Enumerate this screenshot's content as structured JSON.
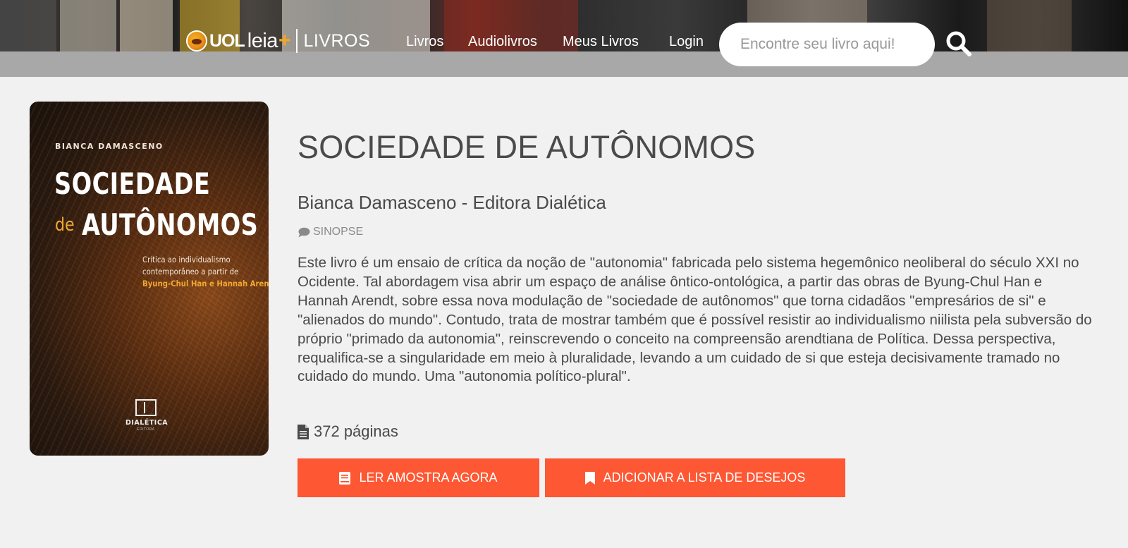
{
  "header": {
    "logo": {
      "brand": "UOL",
      "product": "leia",
      "plus": "+",
      "section": "LIVROS"
    },
    "nav": [
      "Livros",
      "Audiolivros",
      "Meus Livros",
      "Login"
    ],
    "search": {
      "placeholder": "Encontre seu livro aqui!",
      "value": ""
    }
  },
  "cover": {
    "author": "BIANCA DAMASCENO",
    "title_line1": "SOCIEDADE",
    "title_de": "de",
    "title_line2": "AUTÔNOMOS",
    "subtitle_line1": "Crítica ao individualismo",
    "subtitle_line2": "contemporâneo a partir de",
    "subtitle_line3": "Byung-Chul Han e Hannah Arendt",
    "publisher": "DIALÉTICA",
    "publisher_sub": "EDITORA"
  },
  "book": {
    "title": "SOCIEDADE DE AUTÔNOMOS",
    "author_publisher": "Bianca Damasceno - Editora Dialética",
    "synopsis_label": "SINOPSE",
    "synopsis": "Este livro é um ensaio de crítica da noção de \"autonomia\" fabricada pelo sistema hegemônico neoliberal do século XXI no Ocidente. Tal abordagem visa abrir um espaço de análise ôntico-ontológica, a partir das obras de Byung-Chul Han e Hannah Arendt, sobre essa nova modulação de \"sociedade de autônomos\" que torna cidadãos \"empresários de si\" e \"alienados do mundo\". Contudo, trata de mostrar também que é possível resistir ao individualismo niilista pela subversão do próprio \"primado da autonomia\", reinscrevendo o conceito na compreensão arendtiana de Política. Dessa perspectiva, requalifica-se a singularidade em meio à pluralidade, levando a um cuidado de si que esteja decisivamente tramado no cuidado do mundo. Uma \"autonomia político-plural\".",
    "pages": "372 páginas"
  },
  "actions": {
    "read_sample": "LER AMOSTRA AGORA",
    "add_wishlist": "ADICIONAR A LISTA DE DESEJOS"
  },
  "colors": {
    "accent_button": "#fd5733",
    "header_band": "#a8a8a8",
    "page_background": "#f1f1f1",
    "logo_plus": "#f5a623"
  },
  "icons": {
    "search": "search-icon",
    "synopsis": "chat-bubble-icon",
    "pages": "document-icon",
    "read": "book-icon",
    "wishlist": "bookmark-icon"
  }
}
